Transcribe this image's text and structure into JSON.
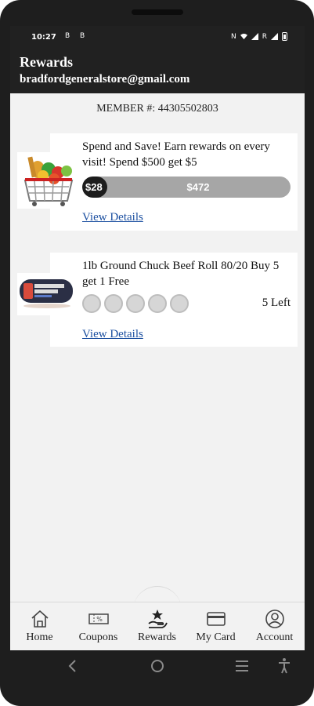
{
  "status_bar": {
    "time": "10:27",
    "left_icons": "Β Β",
    "right_icons": [
      "N",
      "wifi-icon",
      "signal-icon",
      "R",
      "signal-icon",
      "battery-icon"
    ]
  },
  "header": {
    "title": "Rewards",
    "email": "bradfordgeneralstore@gmail.com"
  },
  "member": {
    "text": "MEMBER #: 44305502803"
  },
  "rewards": [
    {
      "image": "grocery-basket-image",
      "title": "Spend and Save! Earn rewards on every visit! Spend $500 get $5",
      "progress_earned": "$28",
      "progress_remaining": "$472",
      "progress_fraction": 0.056,
      "link": "View Details"
    },
    {
      "image": "ground-chuck-image",
      "title": "1lb Ground Chuck Beef Roll 80/20 Buy 5 get 1 Free",
      "punches_total": 5,
      "punches_filled": 0,
      "remaining": "5 Left",
      "link": "View Details"
    }
  ],
  "bottom_nav": [
    {
      "label": "Home",
      "icon": "home-icon"
    },
    {
      "label": "Coupons",
      "icon": "coupon-icon"
    },
    {
      "label": "Rewards",
      "icon": "rewards-icon",
      "active": true
    },
    {
      "label": "My Card",
      "icon": "card-icon"
    },
    {
      "label": "Account",
      "icon": "account-icon"
    }
  ],
  "colors": {
    "header_bg": "#212121",
    "link": "#1b4fa0",
    "progress_fill": "#1c1c1c",
    "progress_track": "#a6a6a6",
    "screen_bg": "#f2f2f2"
  }
}
